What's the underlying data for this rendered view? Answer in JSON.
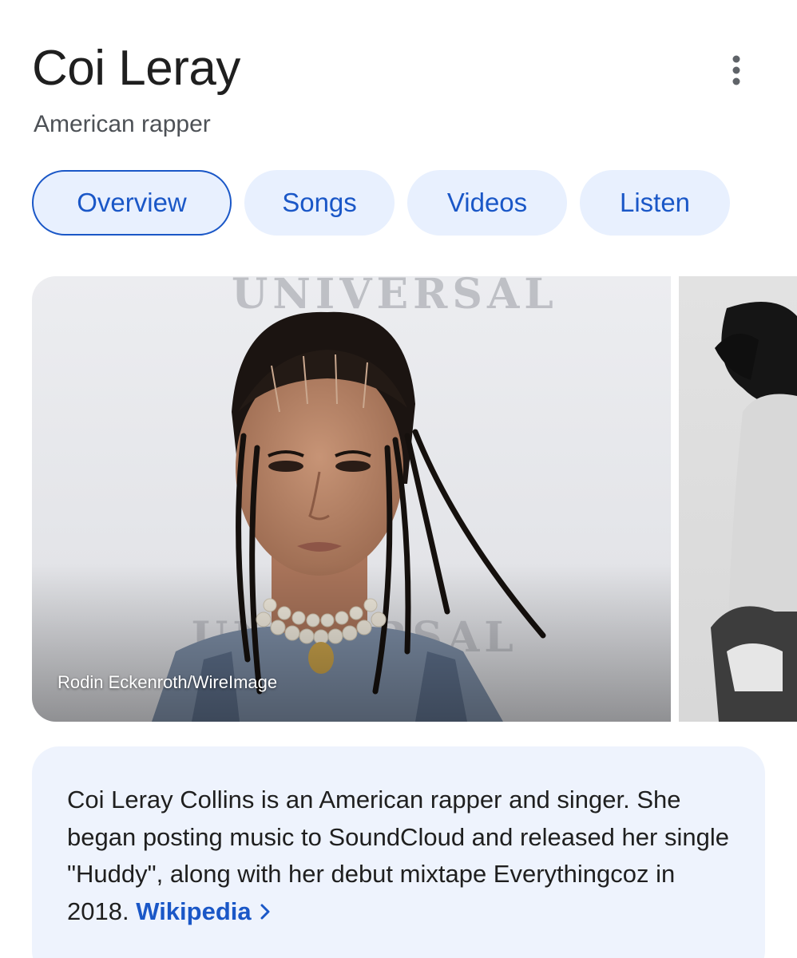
{
  "header": {
    "title": "Coi Leray",
    "subtitle": "American rapper",
    "more_icon": "more-vert-icon"
  },
  "tabs": [
    {
      "label": "Overview",
      "active": true
    },
    {
      "label": "Songs",
      "active": false
    },
    {
      "label": "Videos",
      "active": false
    },
    {
      "label": "Listen",
      "active": false
    }
  ],
  "images": {
    "main_credit": "Rodin Eckenroth/WireImage",
    "backdrop_text": "UNIVERSAL"
  },
  "description": {
    "text": "Coi Leray Collins is an American rapper and singer. She began posting music to SoundCloud and released her single \"Huddy\", along with her debut mixtape Everythingcoz in 2018.",
    "source_label": "Wikipedia",
    "source_icon": "chevron-right-icon"
  },
  "colors": {
    "accent": "#1a57c7",
    "chip_bg": "#e8f0fe",
    "card_bg": "#eef3fd",
    "title": "#1f1f1f",
    "subtitle": "#4d5156"
  }
}
